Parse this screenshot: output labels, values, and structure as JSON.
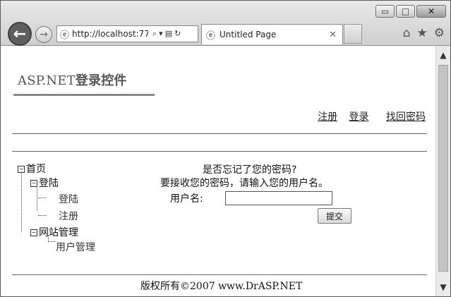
{
  "browser": {
    "address_url": "http://localhost:77",
    "tab_title": "Untitled Page",
    "window_buttons": {
      "minimize": "▭",
      "maximize": "□",
      "close": "✕"
    }
  },
  "page": {
    "site_title_prefix": "ASP.NET",
    "site_title_suffix": "登录控件",
    "top_links": [
      {
        "label": "注册"
      },
      {
        "label": "登录"
      },
      {
        "label": "找回密码"
      }
    ],
    "tree": {
      "root": "首页",
      "groups": [
        {
          "label": "登陆",
          "children": [
            "登陆",
            "注册"
          ]
        },
        {
          "label": "网站管理",
          "children": [
            "用户管理"
          ]
        }
      ]
    },
    "password_recovery": {
      "question": "是否忘记了您的密码?",
      "instruction": "要接收您的密码，请输入您的用户名。",
      "username_label": "用户名:",
      "username_value": "",
      "submit_label": "提交"
    },
    "footer": {
      "copyright": "版权所有©2007 www.DrASP.NET"
    }
  },
  "icons": [
    "back-arrow-icon",
    "forward-arrow-icon",
    "ie-logo-icon",
    "search-icon",
    "compat-view-icon",
    "refresh-icon",
    "close-tab-icon",
    "home-icon",
    "favorites-star-icon",
    "settings-gear-icon"
  ],
  "colors": {
    "chrome": "#d9d9d9",
    "rule": "#888888",
    "text": "#111111"
  }
}
